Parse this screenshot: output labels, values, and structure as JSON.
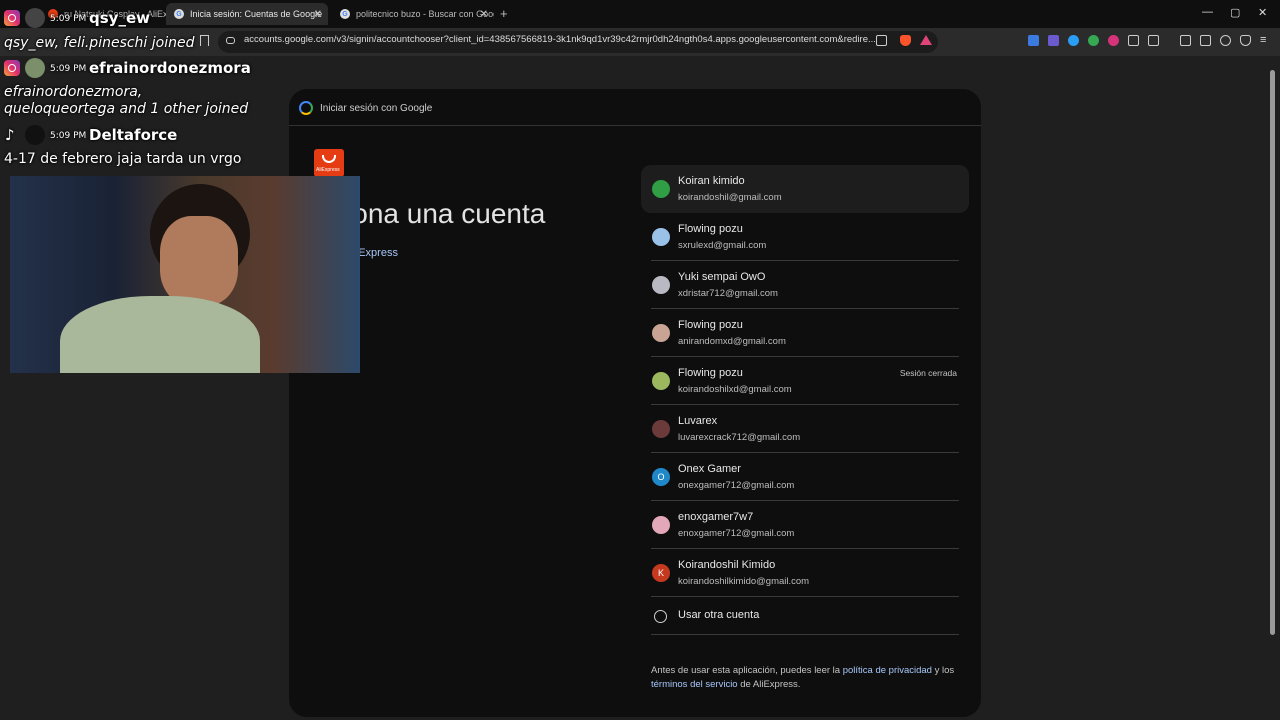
{
  "browser": {
    "tabs": [
      {
        "title": "ru Natsuki Cosplay - AliExpress",
        "active": false
      },
      {
        "title": "Inicia sesión: Cuentas de Google",
        "active": true
      },
      {
        "title": "politecnico buzo - Buscar con Google",
        "active": false
      }
    ],
    "url": "accounts.google.com/v3/signin/accountchooser?client_id=438567566819-3k1nk9qd1vr39c42rmjr0dh24ngth0s4.apps.googleusercontent.com&redire..."
  },
  "signin": {
    "header": "Iniciar sesión con Google",
    "brand_logo_text": "AliExpress",
    "headline": "Selecciona una cuenta",
    "app_link": "AliExpress",
    "accounts": [
      {
        "name": "Koiran kimido",
        "email": "koirandoshil@gmail.com",
        "status": "",
        "avatar_color": "#2f9e44",
        "initial": ""
      },
      {
        "name": "Flowing pozu",
        "email": "sxrulexd@gmail.com",
        "status": "",
        "avatar_color": "#9ac1e8",
        "initial": ""
      },
      {
        "name": "Yuki sempai OwO",
        "email": "xdristar712@gmail.com",
        "status": "",
        "avatar_color": "#b9b9c4",
        "initial": ""
      },
      {
        "name": "Flowing pozu",
        "email": "anirandomxd@gmail.com",
        "status": "",
        "avatar_color": "#c9a494",
        "initial": ""
      },
      {
        "name": "Flowing pozu",
        "email": "koirandoshilxd@gmail.com",
        "status": "Sesión cerrada",
        "avatar_color": "#9bb85f",
        "initial": ""
      },
      {
        "name": "Luvarex",
        "email": "luvarexcrack712@gmail.com",
        "status": "",
        "avatar_color": "#6b3b3b",
        "initial": ""
      },
      {
        "name": "Onex Gamer",
        "email": "onexgamer712@gmail.com",
        "status": "",
        "avatar_color": "#1e88c9",
        "initial": "O"
      },
      {
        "name": "enoxgamer7w7",
        "email": "enoxgamer712@gmail.com",
        "status": "",
        "avatar_color": "#e2a7b8",
        "initial": ""
      },
      {
        "name": "Koirandoshil Kimido",
        "email": "koirandoshilkimido@gmail.com",
        "status": "",
        "avatar_color": "#c5391f",
        "initial": "K"
      }
    ],
    "other_account": "Usar otra cuenta",
    "legal": {
      "before": "Antes de usar esta aplicación, puedes leer la",
      "privacy": "política de privacidad",
      "and": "y los",
      "terms": "términos del servicio",
      "after": "de AliExpress."
    }
  },
  "overlay": {
    "messages": [
      {
        "time": "5:09 PM",
        "user": "qsy_ew",
        "platform": "instagram"
      },
      {
        "text": "qsy_ew, feli.pineschi joined"
      },
      {
        "time": "5:09 PM",
        "user": "efrainordonezmora",
        "platform": "instagram"
      },
      {
        "text": "efrainordonezmora,"
      },
      {
        "text": "queloqueortega and 1 other joined"
      },
      {
        "time": "5:09 PM",
        "user": "Deltaforce",
        "platform": "tiktok"
      },
      {
        "text": "4-17 de febrero jaja tarda un vrgo"
      }
    ]
  }
}
